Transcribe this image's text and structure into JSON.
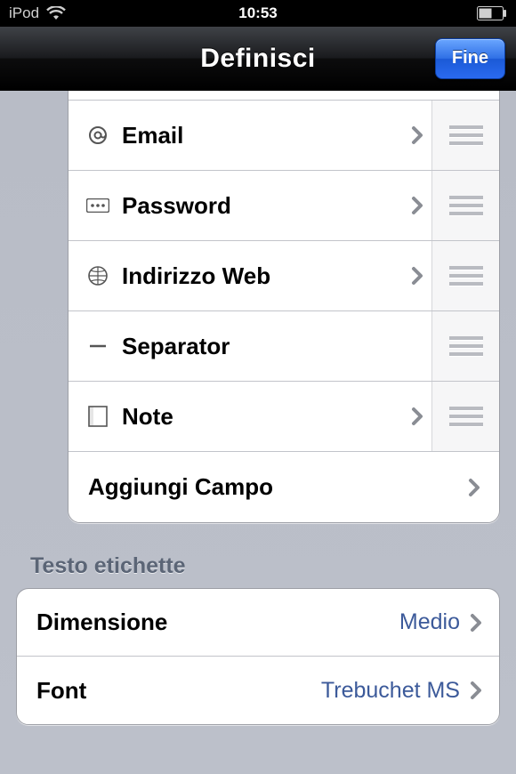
{
  "status": {
    "carrier": "iPod",
    "time": "10:53"
  },
  "nav": {
    "title": "Definisci",
    "done": "Fine"
  },
  "fields": [
    {
      "icon": "at",
      "label": "Email",
      "chevron": true,
      "grip": true
    },
    {
      "icon": "password",
      "label": "Password",
      "chevron": true,
      "grip": true
    },
    {
      "icon": "globe",
      "label": "Indirizzo Web",
      "chevron": true,
      "grip": true
    },
    {
      "icon": "separator",
      "label": "Separator",
      "chevron": false,
      "grip": true
    },
    {
      "icon": "note",
      "label": "Note",
      "chevron": true,
      "grip": true
    }
  ],
  "add_field_label": "Aggiungi Campo",
  "section_labels": {
    "text_labels": "Testo etichette"
  },
  "settings": {
    "size": {
      "label": "Dimensione",
      "value": "Medio"
    },
    "font": {
      "label": "Font",
      "value": "Trebuchet MS"
    }
  }
}
